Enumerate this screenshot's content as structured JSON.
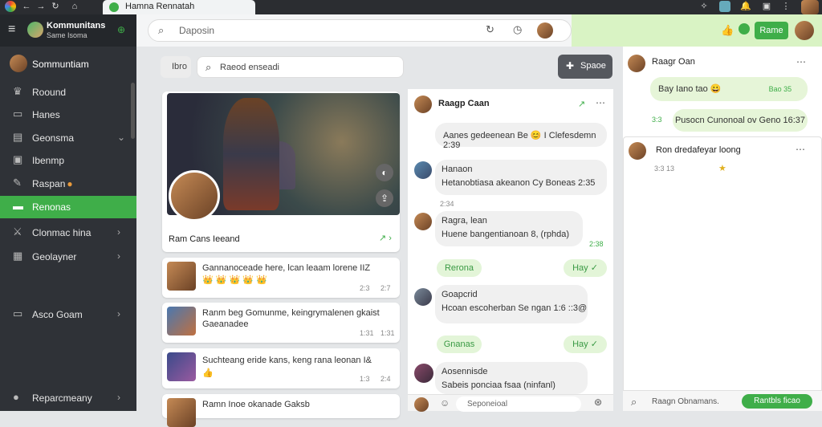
{
  "browser": {
    "tab_title": "Hamna Rennatah"
  },
  "sidebar": {
    "app_title": "Kommunitans",
    "app_subtitle": "Same Isoma",
    "profile_name": "Sommuntiam",
    "items": [
      {
        "label": "Roound",
        "icon": "trophy-icon"
      },
      {
        "label": "Hanes",
        "icon": "chat-icon"
      },
      {
        "label": "Geonsma",
        "icon": "list-icon"
      },
      {
        "label": "Ibenmp",
        "icon": "gamepad-icon"
      },
      {
        "label": "Raspan",
        "icon": "pencil-icon"
      },
      {
        "label": "Renonas",
        "icon": "group-icon"
      },
      {
        "label": "Clonmac hina",
        "icon": "swords-icon"
      },
      {
        "label": "Geolayner",
        "icon": "calendar-icon"
      },
      {
        "label": "Asco Goam",
        "icon": "settings-icon"
      },
      {
        "label": "Reparcmeany",
        "icon": "user-icon"
      }
    ]
  },
  "topbar": {
    "search_placeholder": "Daposin",
    "action_button": "Rame"
  },
  "feed": {
    "filter_label": "Ibro",
    "search_placeholder": "Raeod enseadi",
    "hero_caption": "Ram Cans Ieeand",
    "posts": [
      {
        "text": "Gannanoceade here, lcan leaam lorene IIZ",
        "emoji": "👑 👑 👑 👑 👑",
        "time": "2:3",
        "count": "2:7"
      },
      {
        "text": "Ranm beg Gomunme, keingrymalenen gkaist",
        "sub": "Gaeanadee",
        "time": "1:31",
        "count": "1:31"
      },
      {
        "text": "Suchteang eride kans, keng rana leonan I&",
        "time": "1:3",
        "count": "2:4"
      },
      {
        "text": "Ramn Inoe okanade Gaksb"
      }
    ]
  },
  "chat": {
    "title": "Raagp Caan",
    "messages": [
      {
        "name": "",
        "text": "Aanes gedeenean Be",
        "time": "I Clefesdemn 2:39"
      },
      {
        "name": "Hanaon",
        "text": "Hetanobtiasa akeanon",
        "time": "Cy Boneas 2:35",
        "meta": "2:34"
      },
      {
        "name": "Ragra, lean",
        "text": "Huene bangentianoan",
        "time": "8, (rphda)",
        "meta": "2:38"
      },
      {
        "pill_left": "Rerona",
        "pill_right": "Hay"
      },
      {
        "name": "Goapcrid",
        "text": "Hcoan escoherban Se ngan",
        "time": "1:6 ::3@"
      },
      {
        "pill_left": "Gnanas",
        "pill_right": "Hay"
      },
      {
        "name": "Aosennisde",
        "text": "Sabeis ponciaa fsaa (ninfanl)"
      }
    ],
    "input_placeholder": "Seponeioal"
  },
  "right": {
    "header_name": "Raagr Oan",
    "bubble1": "Bay Iano tao",
    "time1": "Bao 35",
    "time2": "3:3",
    "bubble2": "Pusocn Cunonoal ov Geno 16:37",
    "thread_title": "Ron dredafeyar loong",
    "thread_meta": "3:3 13",
    "input_placeholder": "Raagn Obnamans.",
    "button_label": "Rantbls ficao"
  },
  "colors": {
    "accent": "#3fae49",
    "sidebar": "#2f3237"
  }
}
